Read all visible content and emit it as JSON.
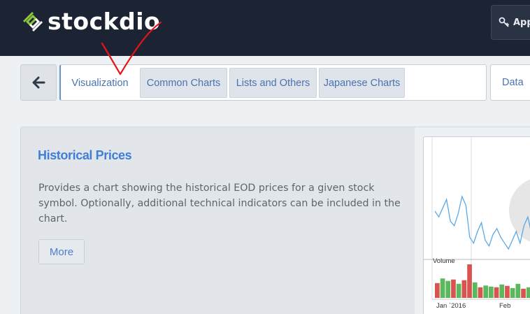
{
  "header": {
    "brand": "stockdio",
    "app_button_label": "App"
  },
  "nav": {
    "tabs": [
      {
        "label": "Visualization",
        "active": true
      },
      {
        "label": "Common Charts",
        "active": false
      },
      {
        "label": "Lists and Others",
        "active": false
      },
      {
        "label": "Japanese Charts",
        "active": false
      }
    ],
    "data_tab_label": "Data"
  },
  "card": {
    "title": "Historical Prices",
    "description": "Provides a chart showing the historical EOD prices for a given stock symbol. Optionally, additional technical indicators can be included in the chart.",
    "more_label": "More"
  },
  "preview": {
    "volume_label": "Volume",
    "x_labels": [
      "Jan `2016",
      "Feb"
    ],
    "price_series": [
      62,
      58,
      64,
      70,
      55,
      52,
      60,
      72,
      66,
      44,
      40,
      48,
      54,
      42,
      38,
      46,
      50,
      44,
      40,
      36,
      42,
      48,
      40,
      52,
      58,
      46,
      40
    ],
    "volume_series": [
      {
        "value": 42,
        "color": "#d9534f"
      },
      {
        "value": 55,
        "color": "#5cb85c"
      },
      {
        "value": 48,
        "color": "#5cb85c"
      },
      {
        "value": 52,
        "color": "#d9534f"
      },
      {
        "value": 40,
        "color": "#5cb85c"
      },
      {
        "value": 50,
        "color": "#d9534f"
      },
      {
        "value": 95,
        "color": "#d9534f"
      },
      {
        "value": 44,
        "color": "#5cb85c"
      },
      {
        "value": 30,
        "color": "#d9534f"
      },
      {
        "value": 35,
        "color": "#5cb85c"
      },
      {
        "value": 32,
        "color": "#5cb85c"
      },
      {
        "value": 30,
        "color": "#d9534f"
      },
      {
        "value": 38,
        "color": "#5cb85c"
      },
      {
        "value": 34,
        "color": "#d9534f"
      },
      {
        "value": 28,
        "color": "#5cb85c"
      },
      {
        "value": 40,
        "color": "#5cb85c"
      },
      {
        "value": 26,
        "color": "#d9534f"
      },
      {
        "value": 30,
        "color": "#5cb85c"
      },
      {
        "value": 36,
        "color": "#d9534f"
      },
      {
        "value": 28,
        "color": "#5cb85c"
      }
    ]
  },
  "annotation": {
    "type": "checkmark",
    "color": "#e8131a"
  },
  "colors": {
    "header_bg": "#1c2433",
    "logo_green": "#8dc63f",
    "link_blue": "#4a72b3",
    "title_blue": "#3f7fd8",
    "price_line": "#5aa9e6"
  }
}
